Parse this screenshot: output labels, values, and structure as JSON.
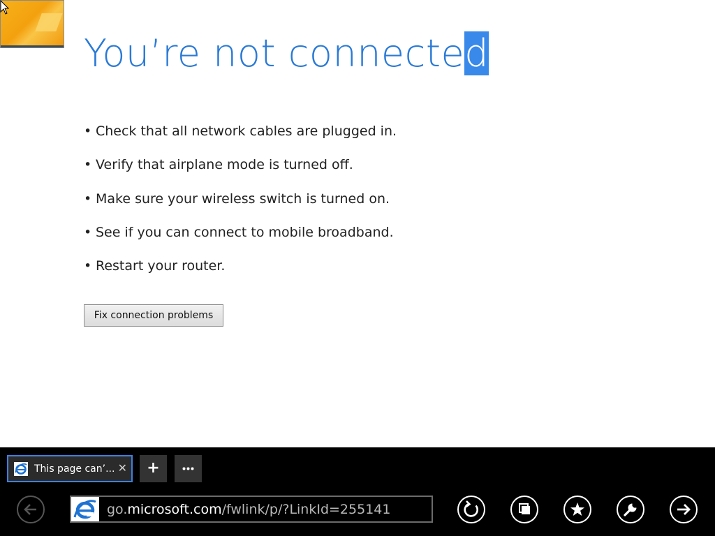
{
  "page": {
    "title_main": "You’re not connecte",
    "title_selected": "d",
    "tips": [
      "Check that all network cables are plugged in.",
      "Verify that airplane mode is turned off.",
      "Make sure your wireless switch is turned on.",
      "See if you can connect to mobile broadband.",
      "Restart your router."
    ],
    "bullet": "•",
    "fix_button_label": "Fix connection problems"
  },
  "tab_bar": {
    "active_tab": {
      "label": "This page can’...",
      "close_glyph": "✕",
      "icon": "ie-logo-icon"
    },
    "new_tab_glyph": "+",
    "tab_tools_glyph": "•••"
  },
  "nav_bar": {
    "url_prefix": "go.",
    "url_domain": "microsoft.com",
    "url_path": "/fwlink/p/?LinkId=255141",
    "site_icon": "ie-logo-icon",
    "buttons": [
      "back-icon",
      "refresh-icon",
      "tabs-icon",
      "favorites-star-icon",
      "tools-wrench-icon",
      "forward-arrow-icon"
    ]
  },
  "colors": {
    "title": "#2a7ad6",
    "selection": "#3889e9",
    "appbar": "#000000",
    "tab_border": "#3f7fdc"
  }
}
